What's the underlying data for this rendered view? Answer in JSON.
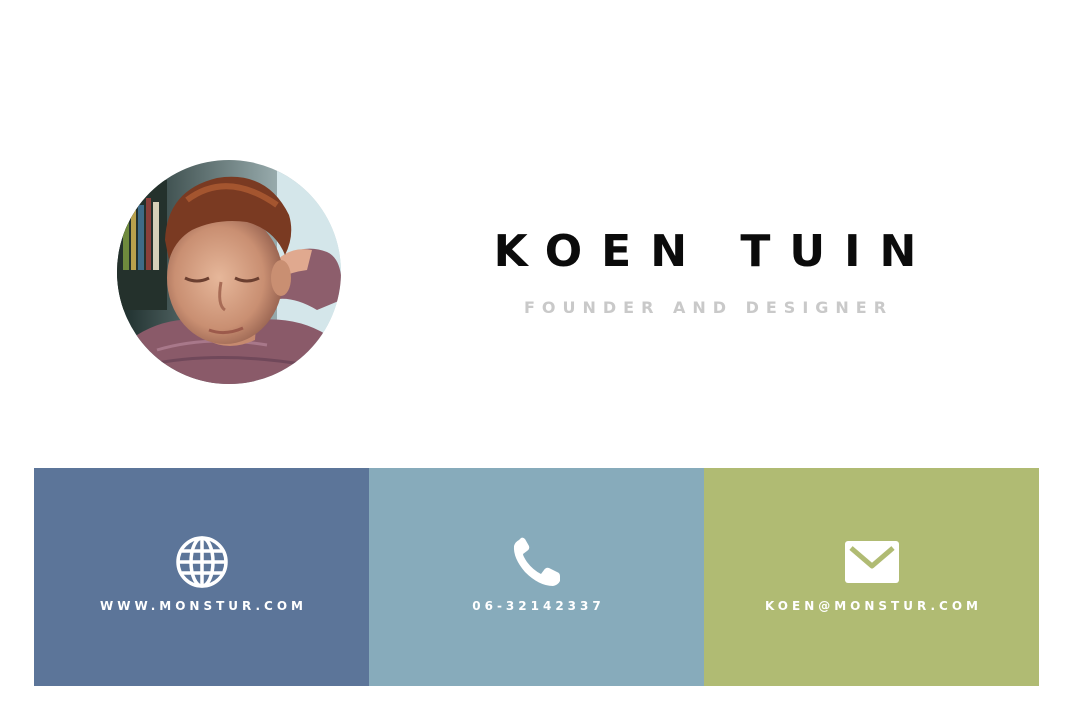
{
  "profile": {
    "name": "KOEN TUIN",
    "role": "FOUNDER AND DESIGNER",
    "avatar_icon": "profile-photo"
  },
  "contacts": [
    {
      "label": "WWW.MONSTUR.COM",
      "icon": "globe-icon",
      "color": "#5c7599"
    },
    {
      "label": "06-32142337",
      "icon": "phone-icon",
      "color": "#87abbb"
    },
    {
      "label": "KOEN@MONSTUR.COM",
      "icon": "envelope-icon",
      "color": "#b0bb73"
    }
  ],
  "colors": {
    "background": "#ffffff",
    "name": "#0b0b0b",
    "role": "#c9c9c9",
    "contact_text": "#ffffff"
  }
}
